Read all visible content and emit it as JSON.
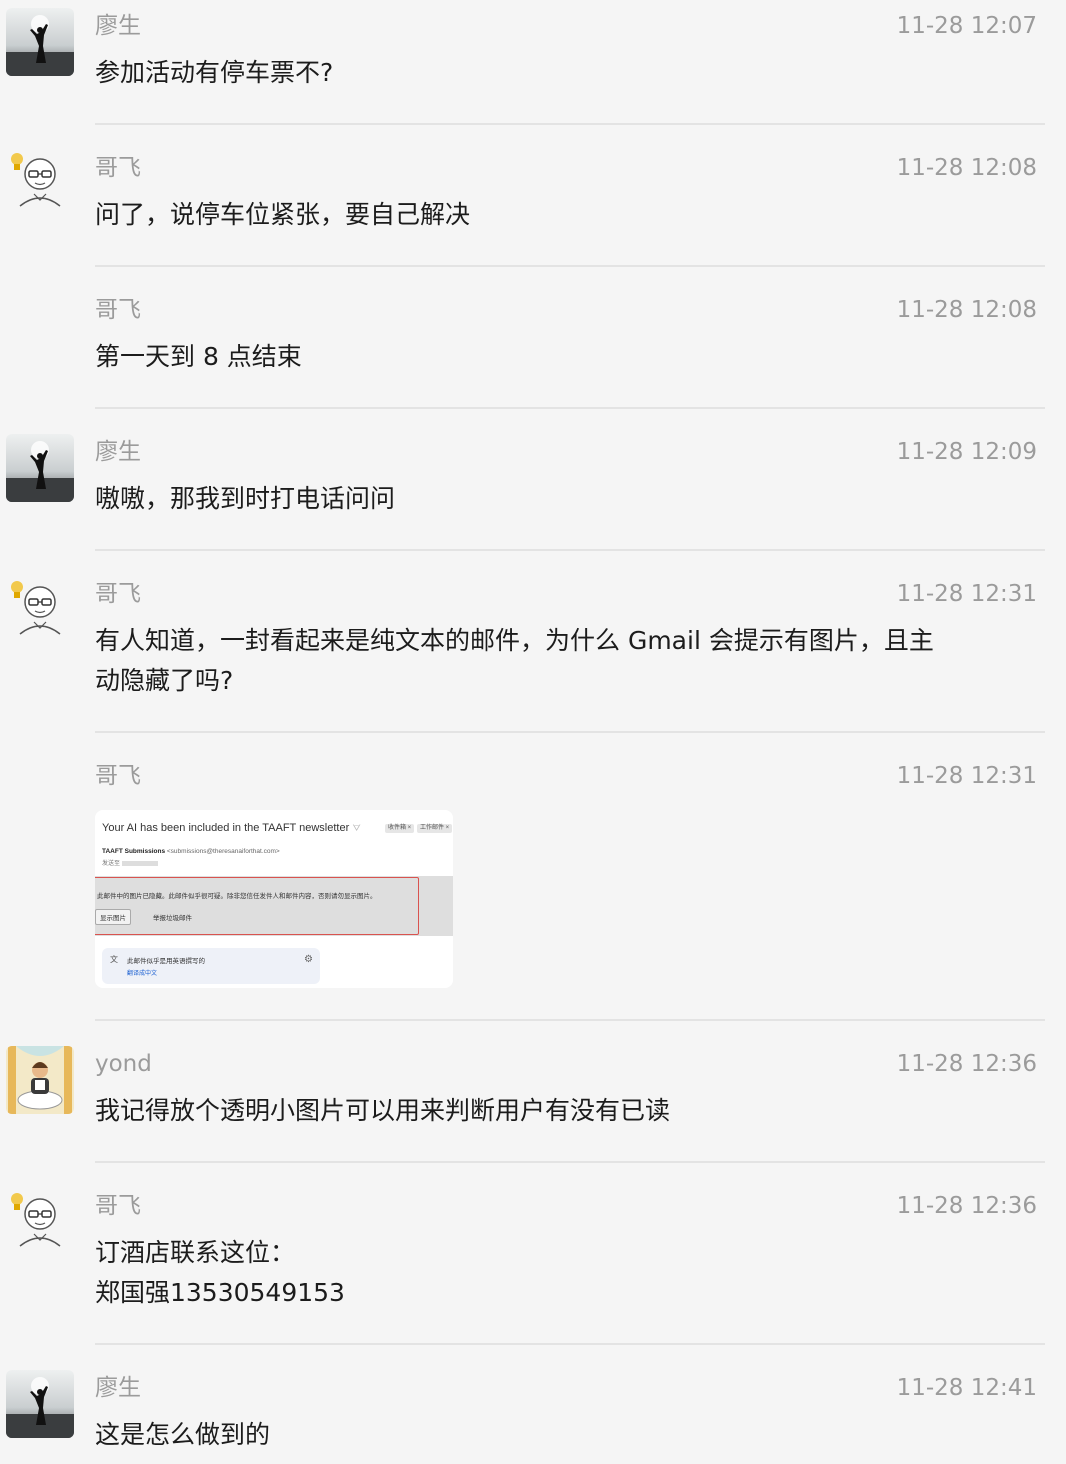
{
  "messages": [
    {
      "sender": "廖生",
      "time": "11-28 12:07",
      "text": "参加活动有停车票不?"
    },
    {
      "sender": "哥飞",
      "time": "11-28 12:08",
      "text": "问了，说停车位紧张，要自己解决"
    },
    {
      "sender": "哥飞",
      "time": "11-28 12:08",
      "text": "第一天到 8 点结束"
    },
    {
      "sender": "廖生",
      "time": "11-28 12:09",
      "text": "嗷嗷，那我到时打电话问问"
    },
    {
      "sender": "哥飞",
      "time": "11-28 12:31",
      "text": "有人知道，一封看起来是纯文本的邮件，为什么 Gmail 会提示有图片，且主\n动隐藏了吗?"
    },
    {
      "sender": "哥飞",
      "time": "11-28 12:31",
      "text": ""
    },
    {
      "sender": "yond",
      "time": "11-28 12:36",
      "text": "我记得放个透明小图片可以用来判断用户有没有已读"
    },
    {
      "sender": "哥飞",
      "time": "11-28 12:36",
      "text": "订酒店联系这位：\n郑国强13530549153"
    },
    {
      "sender": "廖生",
      "time": "11-28 12:41",
      "text": "这是怎么做到的"
    }
  ],
  "email_preview": {
    "subject": "Your AI has been included in the TAAFT newsletter",
    "subject_icon": "importance-marker-icon",
    "tag_inbox": "收件箱 ×",
    "tag_work": "工作邮件 ×",
    "from_name": "TAAFT Submissions",
    "from_addr": "<submissions@theresanaiforthat.com>",
    "to_label": "发送至",
    "warning": "此邮件中的图片已隐藏。此邮件似乎很可疑。除非您信任发件人和邮件内容，否则请勿显示图片。",
    "show_images": "显示图片",
    "report_spam": "举报垃圾邮件",
    "lang_notice": "此邮件似乎是用英语撰写的",
    "translate": "翻译成中文",
    "translate_icon": "translate-icon",
    "settings_icon": "gear-icon"
  },
  "colors": {
    "background": "#f5f5f5",
    "meta_text": "#9b9b9b",
    "body_text": "#1c1c1c",
    "divider": "#e3e3e3",
    "warning_border": "#d9534f",
    "link_blue": "#1a5fd1"
  }
}
